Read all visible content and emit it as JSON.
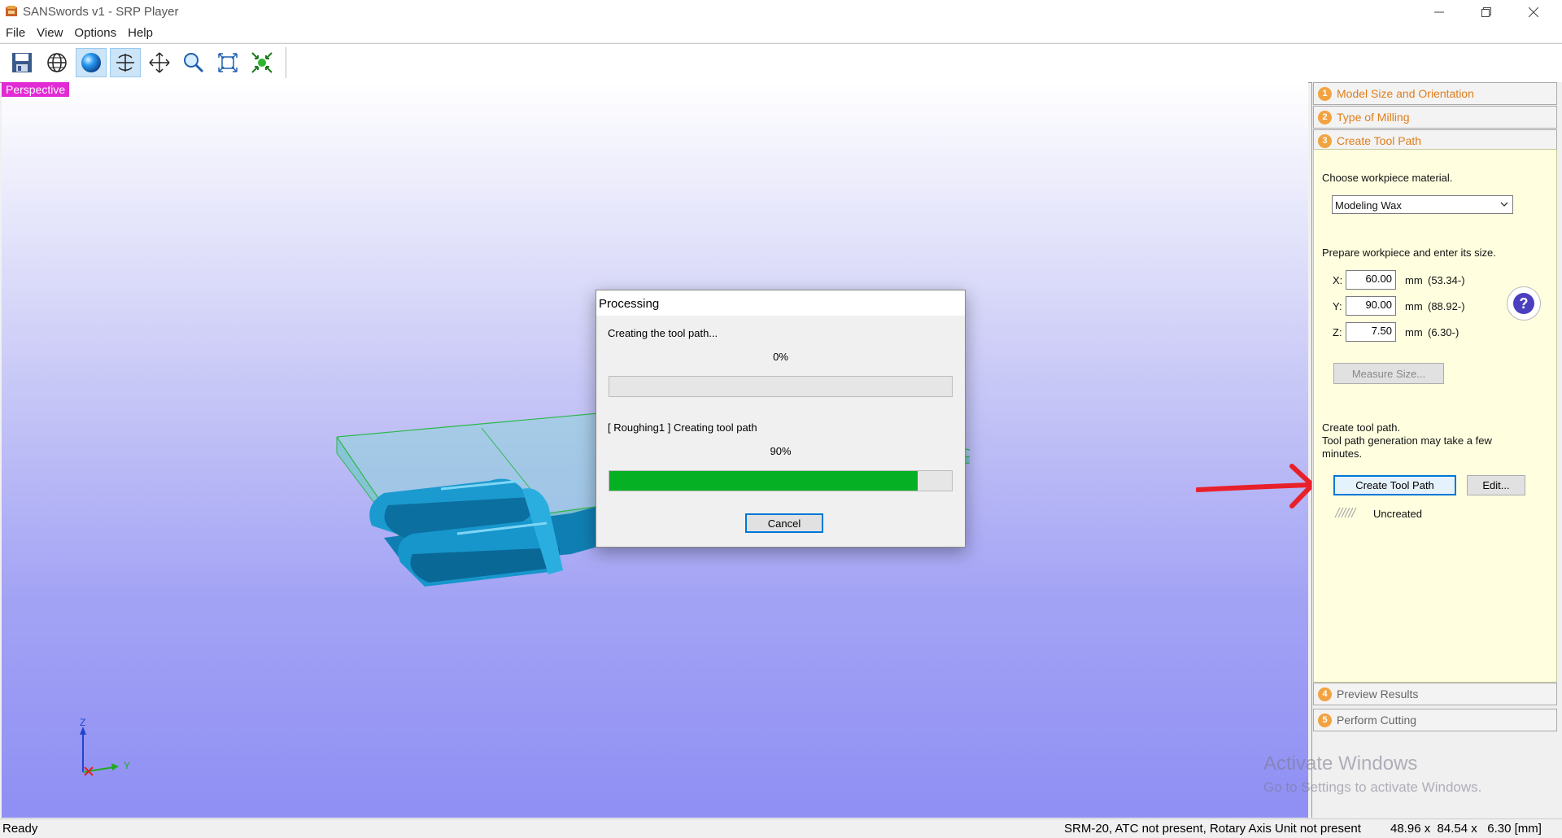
{
  "window": {
    "title": "SANSwords v1 - SRP Player",
    "controls": [
      "minimize",
      "restore",
      "close"
    ]
  },
  "menu": [
    "File",
    "View",
    "Options",
    "Help"
  ],
  "toolbar": {
    "buttons": [
      {
        "icon": "save-icon",
        "active": false
      },
      {
        "icon": "globe-icon",
        "active": false
      },
      {
        "icon": "sphere-icon",
        "active": true
      },
      {
        "icon": "rotate-icon",
        "active": true
      },
      {
        "icon": "pan-icon",
        "active": false
      },
      {
        "icon": "zoom-icon",
        "active": false
      },
      {
        "icon": "fit-view-icon",
        "active": false
      },
      {
        "icon": "center-icon",
        "active": false
      }
    ]
  },
  "viewport": {
    "label": "Perspective",
    "axis_labels": {
      "z": "Z",
      "y": "Y"
    }
  },
  "dialog": {
    "title": "Processing",
    "task1": {
      "label": "Creating the tool path...",
      "percent_text": "0%",
      "progress": 0.0
    },
    "task2": {
      "label": "[ Roughing1 ] Creating tool path",
      "percent_text": "90%",
      "progress": 0.9
    },
    "cancel_label": "Cancel"
  },
  "panel": {
    "steps": [
      {
        "num": "1",
        "label": "Model Size and Orientation"
      },
      {
        "num": "2",
        "label": "Type of Milling"
      },
      {
        "num": "3",
        "label": "Create Tool Path"
      },
      {
        "num": "4",
        "label": "Preview Results"
      },
      {
        "num": "5",
        "label": "Perform Cutting"
      }
    ],
    "material_prompt": "Choose workpiece material.",
    "material_value": "Modeling Wax",
    "size_prompt": "Prepare workpiece and enter its size.",
    "dims": [
      {
        "axis": "X:",
        "value": "60.00",
        "unit": "mm",
        "min": "(53.34-)"
      },
      {
        "axis": "Y:",
        "value": "90.00",
        "unit": "mm",
        "min": "(88.92-)"
      },
      {
        "axis": "Z:",
        "value": "7.50",
        "unit": "mm",
        "min": "(6.30-)"
      }
    ],
    "measure_label": "Measure Size...",
    "create_prompt": "Create tool path.",
    "create_note": "Tool path generation may take a few minutes.",
    "create_btn": "Create Tool Path",
    "edit_btn": "Edit...",
    "status": "Uncreated"
  },
  "statusbar": {
    "left": "Ready",
    "machine": "SRM-20, ATC not present, Rotary Axis Unit not present",
    "size": "48.96 x  84.54 x   6.30 [mm]"
  },
  "watermark": {
    "line1": "Activate Windows",
    "line2": "Go to Settings to activate Windows."
  },
  "colors": {
    "accent_orange": "#e07d1a",
    "progress_green": "#06b025",
    "perspective_tag": "#e22ad5",
    "annotation_arrow": "#e8202a"
  }
}
